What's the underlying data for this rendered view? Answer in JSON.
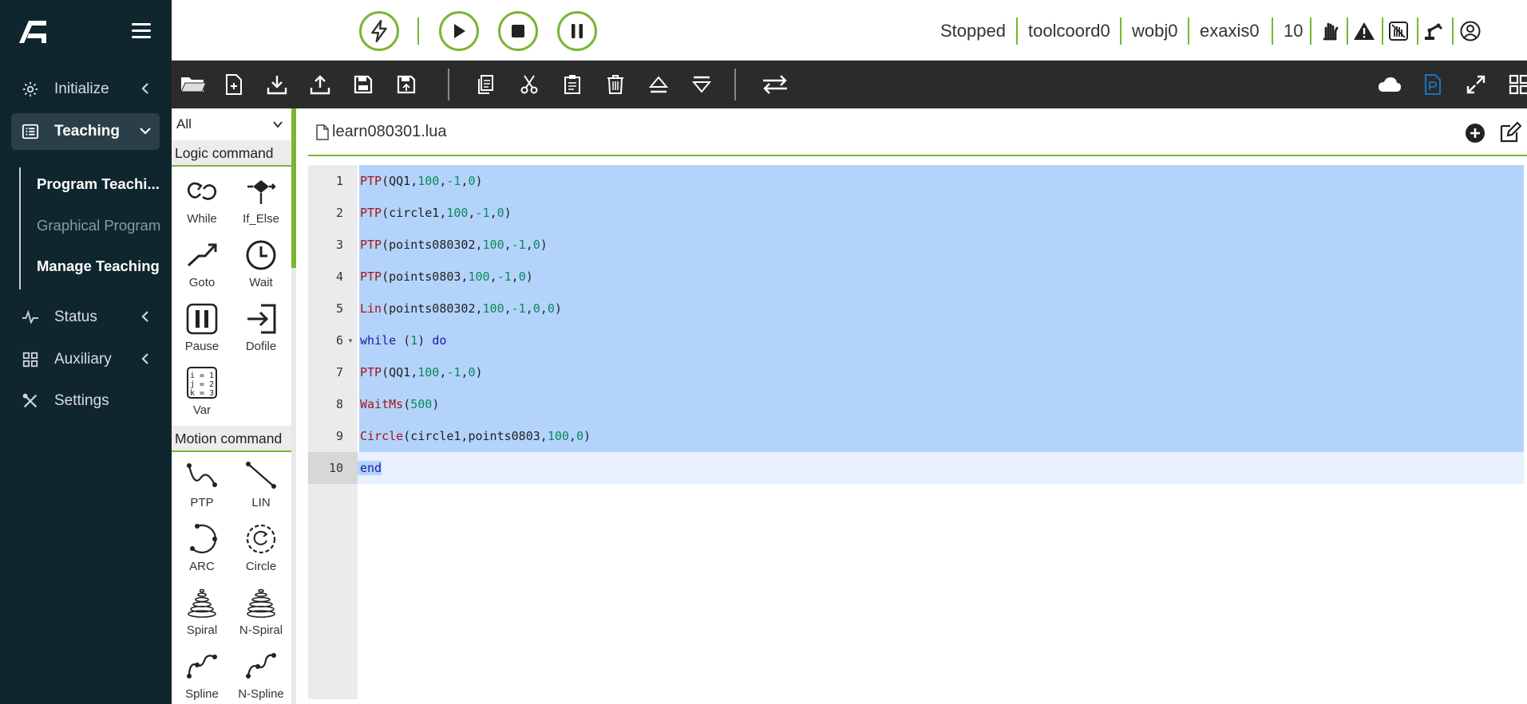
{
  "sidebar": {
    "items": [
      {
        "label": "Initialize",
        "icon": "gear-icon"
      },
      {
        "label": "Teaching",
        "icon": "list-icon"
      },
      {
        "label": "Status",
        "icon": "pulse-icon"
      },
      {
        "label": "Auxiliary",
        "icon": "grid-icon"
      },
      {
        "label": "Settings",
        "icon": "tools-icon"
      }
    ],
    "subitems": [
      "Program Teachi...",
      "Graphical Program",
      "Manage Teaching"
    ]
  },
  "topbar": {
    "status_items": [
      "Stopped",
      "toolcoord0",
      "wobj0",
      "exaxis0",
      "10"
    ]
  },
  "palette": {
    "filter_value": "All",
    "logic_header": "Logic command",
    "motion_header": "Motion command",
    "logic_items": [
      "While",
      "If_Else",
      "Goto",
      "Wait",
      "Pause",
      "Dofile",
      "Var"
    ],
    "motion_items": [
      "PTP",
      "LIN",
      "ARC",
      "Circle",
      "Spiral",
      "N-Spiral",
      "Spline",
      "N-Spline"
    ],
    "var_icon_text": [
      "i = 1",
      "j = 2",
      "k = 3"
    ]
  },
  "editor": {
    "file_name": "learn080301.lua",
    "line_numbers": [
      "1",
      "2",
      "3",
      "4",
      "5",
      "6",
      "7",
      "8",
      "9",
      "10"
    ],
    "lines": [
      [
        {
          "t": "PTP",
          "c": "kw"
        },
        {
          "t": "(QQ1,",
          "c": ""
        },
        {
          "t": "100",
          "c": "num"
        },
        {
          "t": ",",
          "c": ""
        },
        {
          "t": "-1",
          "c": "num"
        },
        {
          "t": ",",
          "c": ""
        },
        {
          "t": "0",
          "c": "num"
        },
        {
          "t": ")",
          "c": ""
        }
      ],
      [
        {
          "t": "PTP",
          "c": "kw"
        },
        {
          "t": "(circle1,",
          "c": ""
        },
        {
          "t": "100",
          "c": "num"
        },
        {
          "t": ",",
          "c": ""
        },
        {
          "t": "-1",
          "c": "num"
        },
        {
          "t": ",",
          "c": ""
        },
        {
          "t": "0",
          "c": "num"
        },
        {
          "t": ")",
          "c": ""
        }
      ],
      [
        {
          "t": "PTP",
          "c": "kw"
        },
        {
          "t": "(points080302,",
          "c": ""
        },
        {
          "t": "100",
          "c": "num"
        },
        {
          "t": ",",
          "c": ""
        },
        {
          "t": "-1",
          "c": "num"
        },
        {
          "t": ",",
          "c": ""
        },
        {
          "t": "0",
          "c": "num"
        },
        {
          "t": ")",
          "c": ""
        }
      ],
      [
        {
          "t": "PTP",
          "c": "kw"
        },
        {
          "t": "(points0803,",
          "c": ""
        },
        {
          "t": "100",
          "c": "num"
        },
        {
          "t": ",",
          "c": ""
        },
        {
          "t": "-1",
          "c": "num"
        },
        {
          "t": ",",
          "c": ""
        },
        {
          "t": "0",
          "c": "num"
        },
        {
          "t": ")",
          "c": ""
        }
      ],
      [
        {
          "t": "Lin",
          "c": "kw"
        },
        {
          "t": "(points080302,",
          "c": ""
        },
        {
          "t": "100",
          "c": "num"
        },
        {
          "t": ",",
          "c": ""
        },
        {
          "t": "-1",
          "c": "num"
        },
        {
          "t": ",",
          "c": ""
        },
        {
          "t": "0",
          "c": "num"
        },
        {
          "t": ",",
          "c": ""
        },
        {
          "t": "0",
          "c": "num"
        },
        {
          "t": ")",
          "c": ""
        }
      ],
      [
        {
          "t": "while",
          "c": "kwb"
        },
        {
          "t": " (",
          "c": ""
        },
        {
          "t": "1",
          "c": "num"
        },
        {
          "t": ") ",
          "c": ""
        },
        {
          "t": "do",
          "c": "kwb"
        }
      ],
      [
        {
          "t": "PTP",
          "c": "kw"
        },
        {
          "t": "(QQ1,",
          "c": ""
        },
        {
          "t": "100",
          "c": "num"
        },
        {
          "t": ",",
          "c": ""
        },
        {
          "t": "-1",
          "c": "num"
        },
        {
          "t": ",",
          "c": ""
        },
        {
          "t": "0",
          "c": "num"
        },
        {
          "t": ")",
          "c": ""
        }
      ],
      [
        {
          "t": "WaitMs",
          "c": "kw"
        },
        {
          "t": "(",
          "c": ""
        },
        {
          "t": "500",
          "c": "num"
        },
        {
          "t": ")",
          "c": ""
        }
      ],
      [
        {
          "t": "Circle",
          "c": "kw"
        },
        {
          "t": "(circle1,points0803,",
          "c": ""
        },
        {
          "t": "100",
          "c": "num"
        },
        {
          "t": ",",
          "c": ""
        },
        {
          "t": "0",
          "c": "num"
        },
        {
          "t": ")",
          "c": ""
        }
      ],
      [
        {
          "t": "end",
          "c": "kwb"
        }
      ]
    ]
  },
  "colors": {
    "accent": "#7ab532",
    "sidebar_bg": "#10262e",
    "toolbar_bg": "#2b2b2b",
    "selection": "#b4d3fb",
    "keyword_red": "#a31515",
    "keyword_blue": "#1a1aa6"
  }
}
